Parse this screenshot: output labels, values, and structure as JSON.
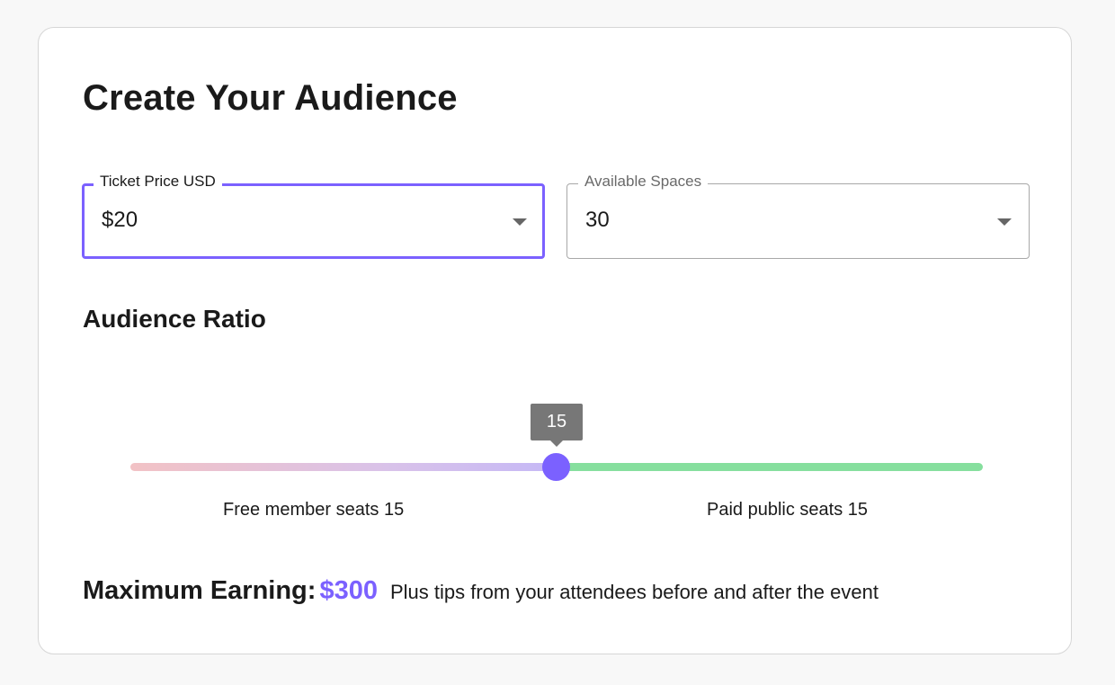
{
  "page": {
    "title": "Create Your Audience"
  },
  "ticket_price": {
    "label": "Ticket Price USD",
    "value": "$20",
    "focused": true
  },
  "available_spaces": {
    "label": "Available Spaces",
    "value": "30"
  },
  "audience_ratio": {
    "title": "Audience Ratio",
    "slider_value": "15",
    "slider_min": 0,
    "slider_max": 30,
    "free_label": "Free member seats 15",
    "paid_label": "Paid public seats 15"
  },
  "earning": {
    "label": "Maximum Earning:",
    "amount": "$300",
    "note": "Plus tips from your attendees before and after the event"
  },
  "colors": {
    "accent": "#7b61ff",
    "track_left_start": "#f2c2c5",
    "track_left_end": "#c5b8f6",
    "track_right": "#86df9e",
    "tooltip_bg": "#777777"
  }
}
